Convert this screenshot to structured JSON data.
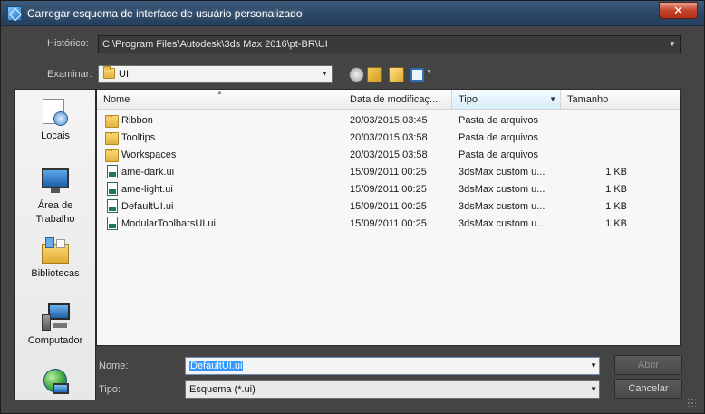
{
  "window": {
    "title": "Carregar esquema de interface de usuário personalizado",
    "close_label": "✕"
  },
  "history": {
    "label": "Histórico:",
    "value": "C:\\Program Files\\Autodesk\\3ds Max 2016\\pt-BR\\UI"
  },
  "look_in": {
    "label": "Examinar:",
    "value": "UI"
  },
  "places": [
    {
      "label": "Locais",
      "icon": "recent-places-icon"
    },
    {
      "label": "Área de\nTrabalho",
      "icon": "desktop-icon"
    },
    {
      "label": "Bibliotecas",
      "icon": "libraries-icon"
    },
    {
      "label": "Computador",
      "icon": "computer-icon"
    },
    {
      "label": "",
      "icon": "network-icon"
    }
  ],
  "columns": {
    "name": "Nome",
    "date": "Data de modificaç...",
    "type": "Tipo",
    "size": "Tamanho"
  },
  "files": [
    {
      "name": "Ribbon",
      "date": "20/03/2015 03:45",
      "type": "Pasta de arquivos",
      "size": "",
      "kind": "folder"
    },
    {
      "name": "Tooltips",
      "date": "20/03/2015 03:58",
      "type": "Pasta de arquivos",
      "size": "",
      "kind": "folder"
    },
    {
      "name": "Workspaces",
      "date": "20/03/2015 03:58",
      "type": "Pasta de arquivos",
      "size": "",
      "kind": "folder"
    },
    {
      "name": "ame-dark.ui",
      "date": "15/09/2011 00:25",
      "type": "3dsMax custom u...",
      "size": "1 KB",
      "kind": "doc"
    },
    {
      "name": "ame-light.ui",
      "date": "15/09/2011 00:25",
      "type": "3dsMax custom u...",
      "size": "1 KB",
      "kind": "doc"
    },
    {
      "name": "DefaultUI.ui",
      "date": "15/09/2011 00:25",
      "type": "3dsMax custom u...",
      "size": "1 KB",
      "kind": "doc"
    },
    {
      "name": "ModularToolbarsUI.ui",
      "date": "15/09/2011 00:25",
      "type": "3dsMax custom u...",
      "size": "1 KB",
      "kind": "doc"
    }
  ],
  "filename": {
    "label": "Nome:",
    "value": "DefaultUI.ui"
  },
  "filetype": {
    "label": "Tipo:",
    "value": "Esquema (*.ui)"
  },
  "buttons": {
    "open": "Abrir",
    "cancel": "Cancelar"
  },
  "colors": {
    "titlebar": "#2a4563",
    "window_bg": "#444444",
    "list_bg": "#f7f7f7",
    "selection": "#3399ff"
  }
}
